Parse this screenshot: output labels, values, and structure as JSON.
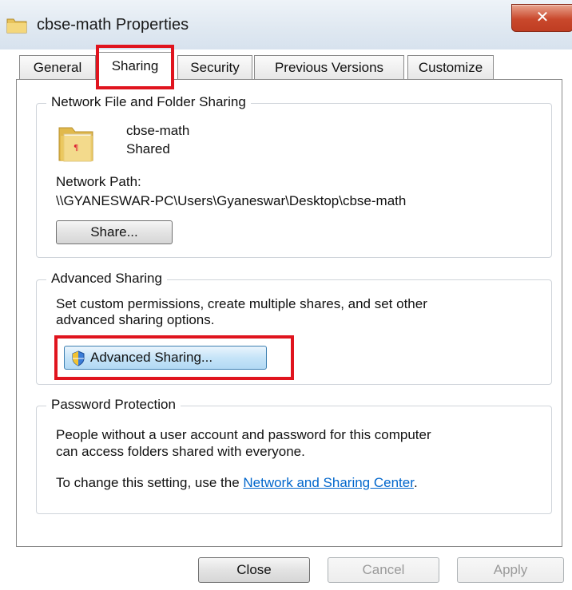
{
  "window": {
    "title": "cbse-math Properties",
    "close_label": "✕"
  },
  "tabs": [
    {
      "label": "General"
    },
    {
      "label": "Sharing"
    },
    {
      "label": "Security"
    },
    {
      "label": "Previous Versions"
    },
    {
      "label": "Customize"
    }
  ],
  "network_sharing": {
    "group_label": "Network File and Folder Sharing",
    "folder_name": "cbse-math",
    "status": "Shared",
    "path_label": "Network Path:",
    "path_value": "\\\\GYANESWAR-PC\\Users\\Gyaneswar\\Desktop\\cbse-math",
    "share_button": "Share..."
  },
  "advanced_sharing": {
    "group_label": "Advanced Sharing",
    "description_line1": "Set custom permissions, create multiple shares, and set other",
    "description_line2": "advanced sharing options.",
    "button_label": "Advanced Sharing..."
  },
  "password_protection": {
    "group_label": "Password Protection",
    "line1": "People without a user account and password for this computer",
    "line2": "can access folders shared with everyone.",
    "change_prefix": "To change this setting, use the ",
    "link_text": "Network and Sharing Center",
    "change_suffix": "."
  },
  "footer": {
    "close": "Close",
    "cancel": "Cancel",
    "apply": "Apply"
  }
}
